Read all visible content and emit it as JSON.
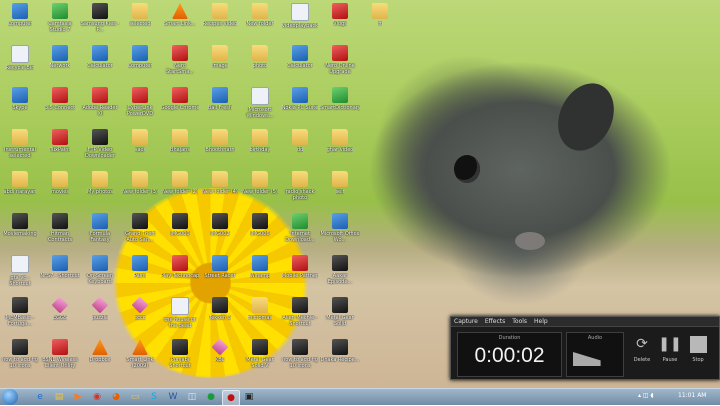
{
  "desktop_icons": [
    {
      "label": "Computer",
      "type": "app"
    },
    {
      "label": "Recycle Bin",
      "type": "doc"
    },
    {
      "label": "Skype",
      "type": "app"
    },
    {
      "label": "Instrumental selected",
      "type": "folder"
    },
    {
      "label": "abdi narayan",
      "type": "folder"
    },
    {
      "label": "Moviemaking",
      "type": "dark"
    },
    {
      "label": "gta vc - Shortcut",
      "type": "doc"
    },
    {
      "label": "MEMBasic - Fortuga...",
      "type": "dark"
    },
    {
      "label": "how to add fig 10 icons",
      "type": "dark"
    },
    {
      "label": "Camtasia Studio 7",
      "type": "green"
    },
    {
      "label": "Network",
      "type": "app"
    },
    {
      "label": "3.5 Connect",
      "type": "red"
    },
    {
      "label": "TuxPaint",
      "type": "red"
    },
    {
      "label": "movies",
      "type": "folder"
    },
    {
      "label": "Hitman Contracts",
      "type": "dark"
    },
    {
      "label": "NFS7 - Shortcut",
      "type": "app"
    },
    {
      "label": "EGGS",
      "type": "pink"
    },
    {
      "label": "BSNL Wireless Client Utility",
      "type": "red"
    },
    {
      "label": "Samsung Kies - P...",
      "type": "dark"
    },
    {
      "label": "Calculator",
      "type": "app"
    },
    {
      "label": "Adobe Reader XI",
      "type": "red"
    },
    {
      "label": "FTP Video Downloader",
      "type": "dark"
    },
    {
      "label": "My photos",
      "type": "folder"
    },
    {
      "label": "Formula Fantasy",
      "type": "app"
    },
    {
      "label": "On-Screen Keyboard",
      "type": "app"
    },
    {
      "label": "puzzle",
      "type": "pink"
    },
    {
      "label": "Dropbox",
      "type": "vlc"
    },
    {
      "label": "selected",
      "type": "folder"
    },
    {
      "label": "Computer",
      "type": "app"
    },
    {
      "label": "CyberLink PowerDVD",
      "type": "red"
    },
    {
      "label": "sadi",
      "type": "folder"
    },
    {
      "label": "New folder (3)",
      "type": "folder"
    },
    {
      "label": "Grand Theft Auto San...",
      "type": "dark"
    },
    {
      "label": "Paint",
      "type": "app"
    },
    {
      "label": "cccc",
      "type": "pink"
    },
    {
      "label": "Smart Link (2009)",
      "type": "vlc"
    },
    {
      "label": "Smart Link...",
      "type": "vlc"
    },
    {
      "label": "Nero StartSma...",
      "type": "red"
    },
    {
      "label": "Google Chrome",
      "type": "red"
    },
    {
      "label": "Bhajans",
      "type": "folder"
    },
    {
      "label": "New folder (2)",
      "type": "folder"
    },
    {
      "label": "IMG000",
      "type": "dark"
    },
    {
      "label": "Play Technocap",
      "type": "red"
    },
    {
      "label": "the house of the dead",
      "type": "doc"
    },
    {
      "label": "Punjabi Shortcut",
      "type": "dark"
    },
    {
      "label": "Recipes video",
      "type": "folder"
    },
    {
      "label": "image",
      "type": "folder"
    },
    {
      "label": "Ball Fresh",
      "type": "app"
    },
    {
      "label": "Bhoothnath",
      "type": "folder"
    },
    {
      "label": "New folder (4)",
      "type": "folder"
    },
    {
      "label": "IMG002",
      "type": "dark"
    },
    {
      "label": "Street Racer",
      "type": "app"
    },
    {
      "label": "Tekken 3",
      "type": "dark"
    },
    {
      "label": "KBC",
      "type": "pink"
    },
    {
      "label": "New folder",
      "type": "folder"
    },
    {
      "label": "photo",
      "type": "folder"
    },
    {
      "label": "Microsoft Windows...",
      "type": "doc"
    },
    {
      "label": "birthday",
      "type": "folder"
    },
    {
      "label": "New folder (5)",
      "type": "folder"
    },
    {
      "label": "IMG006",
      "type": "dark"
    },
    {
      "label": "Winamp",
      "type": "app"
    },
    {
      "label": "micromax",
      "type": "folder"
    },
    {
      "label": "Metal Gear Solid V",
      "type": "dark"
    },
    {
      "label": "videoplayback",
      "type": "doc"
    },
    {
      "label": "Calculator",
      "type": "app"
    },
    {
      "label": "Nokia PC Suite",
      "type": "app"
    },
    {
      "label": "dd",
      "type": "folder"
    },
    {
      "label": "radio shack photo",
      "type": "folder"
    },
    {
      "label": "Internet Download...",
      "type": "green"
    },
    {
      "label": "Mobile Partner",
      "type": "red"
    },
    {
      "label": "Alien Mechie - Shortcut",
      "type": "dark"
    },
    {
      "label": "how to add fig 10 icons",
      "type": "dark"
    },
    {
      "label": "Vlogs",
      "type": "red"
    },
    {
      "label": "Nero Online Upgrade",
      "type": "red"
    },
    {
      "label": "SmartDictionary",
      "type": "green"
    },
    {
      "label": "ghar video",
      "type": "folder"
    },
    {
      "label": "self",
      "type": "folder"
    },
    {
      "label": "Microsoft Office Wo...",
      "type": "app"
    },
    {
      "label": "Aakar Episode...",
      "type": "dark"
    },
    {
      "label": "Metal Gear Solid",
      "type": "dark"
    },
    {
      "label": "Dhaka Recipe...",
      "type": "dark"
    },
    {
      "label": "ff",
      "type": "folder"
    }
  ],
  "recorder": {
    "menu": [
      "Capture",
      "Effects",
      "Tools",
      "Help"
    ],
    "duration_label": "Duration",
    "duration": "0:00:02",
    "audio_label": "Audio",
    "audio_level": 0.6,
    "buttons": {
      "delete": "Delete",
      "pause": "Pause",
      "stop": "Stop"
    }
  },
  "taskbar": {
    "items": [
      {
        "name": "ie-icon",
        "glyph": "e",
        "color": "#1e6bd6"
      },
      {
        "name": "explorer-icon",
        "glyph": "▤",
        "color": "#f2c53a"
      },
      {
        "name": "media-player-icon",
        "glyph": "▶",
        "color": "#ff7a1a"
      },
      {
        "name": "chrome-icon",
        "glyph": "◉",
        "color": "#d93025"
      },
      {
        "name": "firefox-icon",
        "glyph": "◕",
        "color": "#e66000"
      },
      {
        "name": "folder-icon",
        "glyph": "▭",
        "color": "#f2c53a"
      },
      {
        "name": "skype-icon",
        "glyph": "S",
        "color": "#00aff0"
      },
      {
        "name": "word-icon",
        "glyph": "W",
        "color": "#2b579a"
      },
      {
        "name": "network-icon",
        "glyph": "◫",
        "color": "#dfe8f0"
      },
      {
        "name": "camtasia-icon",
        "glyph": "●",
        "color": "#1a9b3c"
      },
      {
        "name": "recorder-icon",
        "glyph": "●",
        "color": "#c01010"
      },
      {
        "name": "monitor-icon",
        "glyph": "▣",
        "color": "#222"
      }
    ],
    "clock": "11:01 AM"
  }
}
